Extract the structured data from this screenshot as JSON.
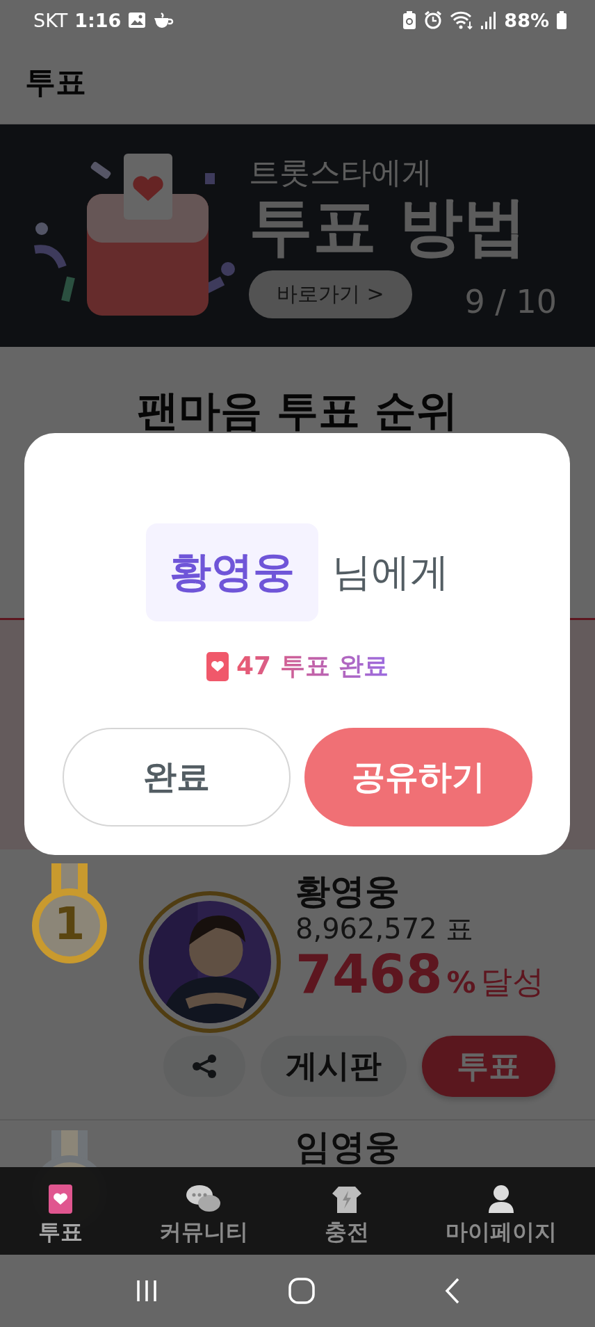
{
  "status_bar": {
    "carrier": "SKT",
    "time": "1:16",
    "battery": "88%"
  },
  "header": {
    "title": "투표"
  },
  "banner": {
    "subtitle": "트롯스타에게",
    "title": "투표 방법",
    "button": "바로가기 >",
    "counter": "9 / 10"
  },
  "ranking": {
    "title": "팬마음 투표 순위",
    "rows": [
      {
        "color": "#c99a2e",
        "rank": "1",
        "name": "황영웅",
        "votes": "8,962,572 표",
        "percent": "7468",
        "percent_unit": "%",
        "achieved": "달성",
        "board_button": "게시판",
        "vote_button": "투표"
      },
      {
        "color": "#707478",
        "name": "임영웅"
      }
    ]
  },
  "bottom_nav": [
    {
      "label": "투표",
      "selected": true
    },
    {
      "label": "커뮤니티",
      "selected": false
    },
    {
      "label": "충전",
      "selected": false
    },
    {
      "label": "마이페이지",
      "selected": false
    }
  ],
  "dialog": {
    "name": "황영웅",
    "suffix": "님에게",
    "result": "47 투표 완료",
    "buttons": [
      {
        "label": "완료",
        "kind": "secondary"
      },
      {
        "label": "공유하기",
        "kind": "primary"
      }
    ]
  }
}
